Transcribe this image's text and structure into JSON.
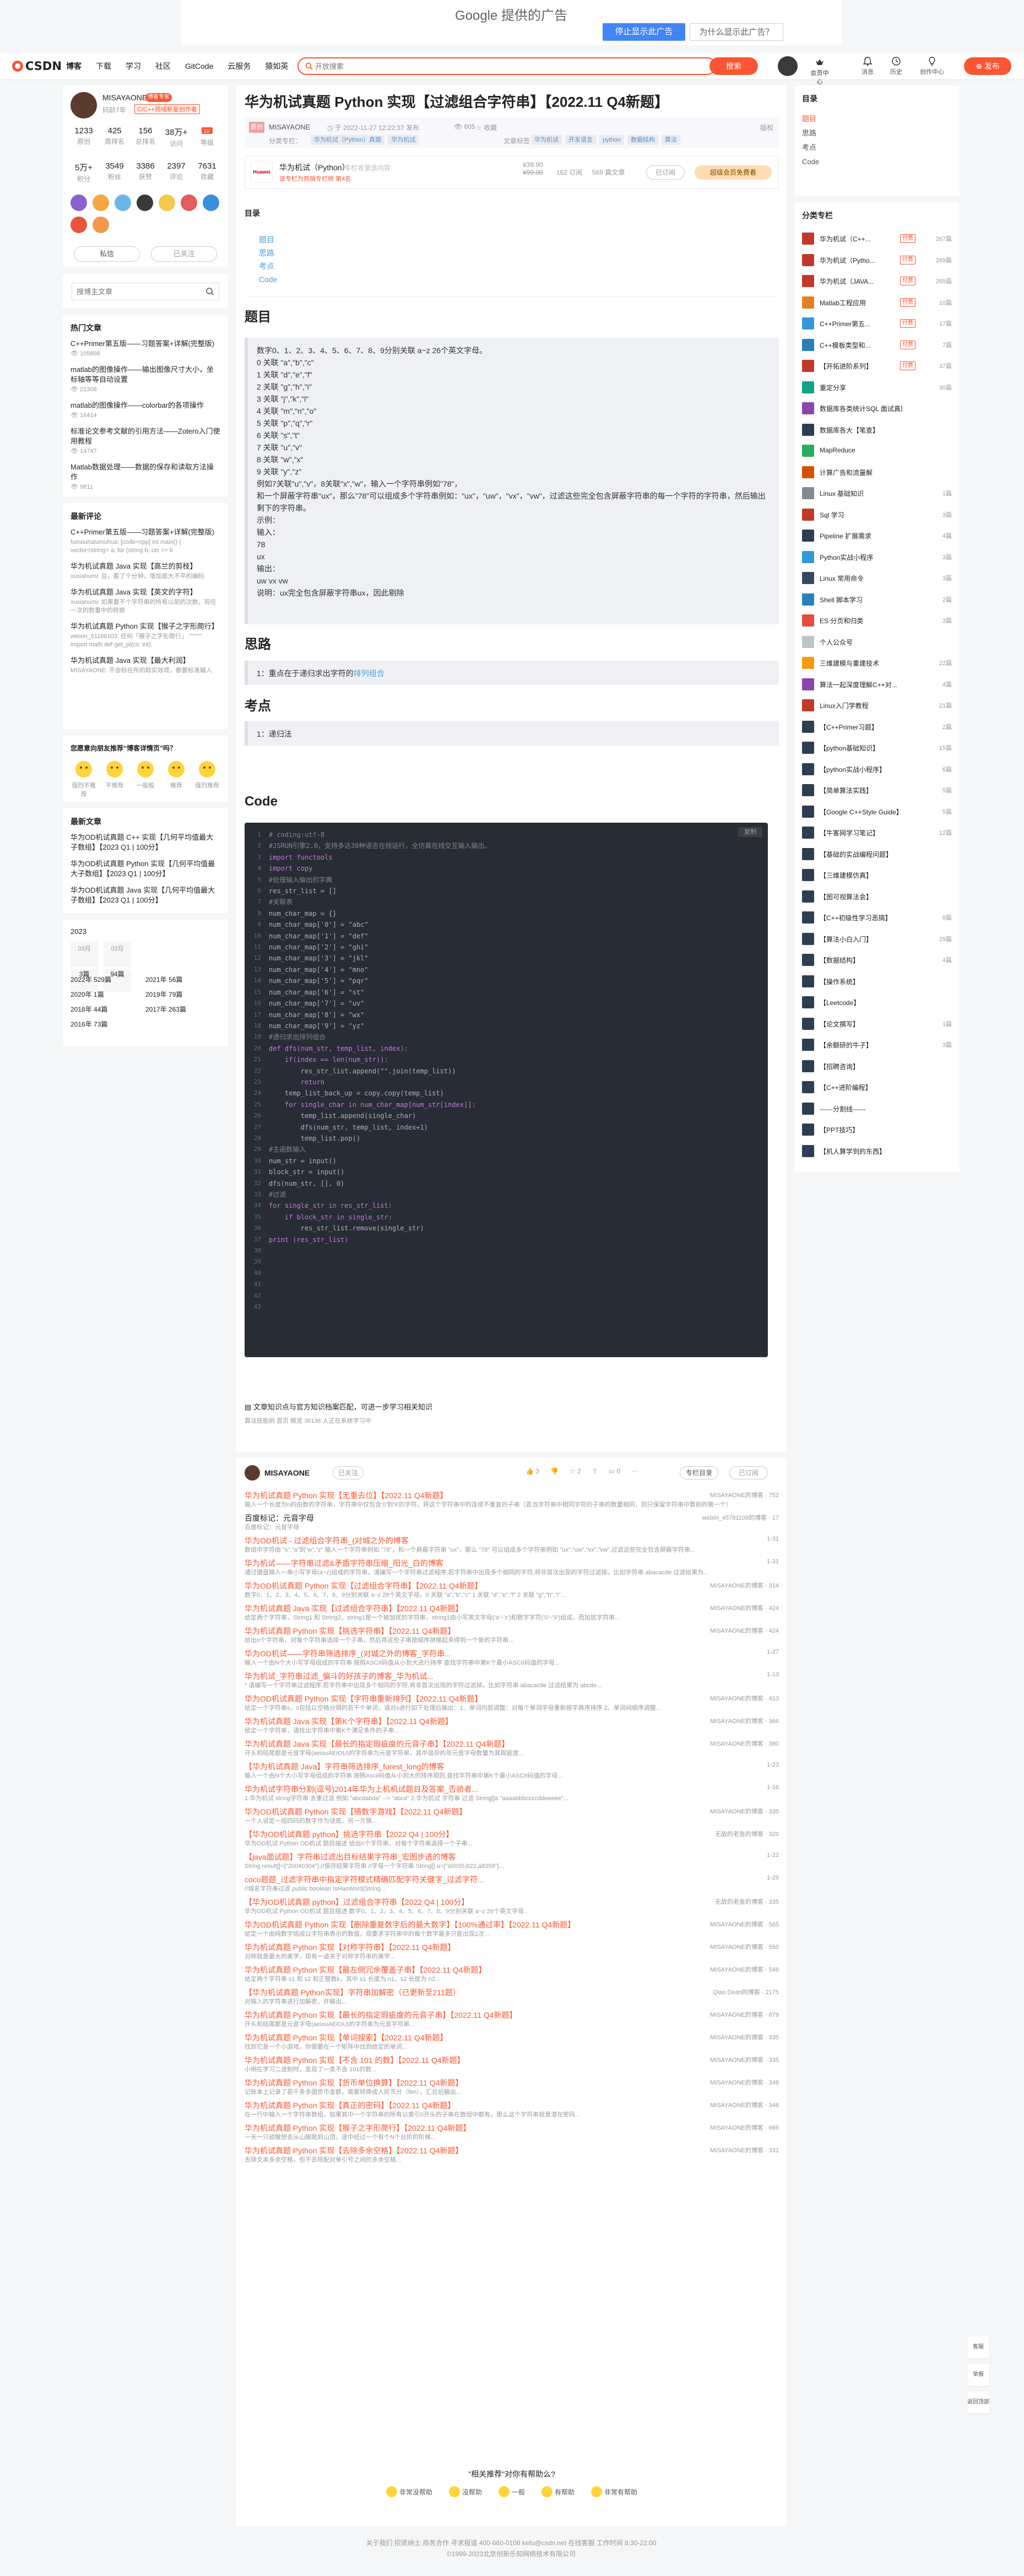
{
  "ad": {
    "brand": "Google 提供的广告",
    "stop_label": "停止显示此广告",
    "why_label": "为什么显示此广告？"
  },
  "toolbar": {
    "logo": "CSDN",
    "nav": [
      "博客",
      "下载",
      "学习",
      "社区",
      "GitCode",
      "云服务",
      "猿如英"
    ],
    "search_placeholder": "开放搜索",
    "search_button": "搜索",
    "vip_label": "会员中心",
    "items": [
      "消息",
      "历史",
      "创作中心"
    ],
    "publish_label": "发布"
  },
  "profile": {
    "name": "MISAYAONE",
    "badge": "博客专家",
    "code_age": "码龄7年",
    "blog_tag": "C/C++领域新星创作者",
    "stats1": [
      {
        "v": "1233",
        "l": "原创"
      },
      {
        "v": "425",
        "l": "周排名"
      },
      {
        "v": "156",
        "l": "总排名"
      },
      {
        "v": "38万+",
        "l": "访问"
      },
      {
        "v": "",
        "l": "等级"
      }
    ],
    "stats2": [
      {
        "v": "5万+",
        "l": "积分"
      },
      {
        "v": "3549",
        "l": "粉丝"
      },
      {
        "v": "3386",
        "l": "获赞"
      },
      {
        "v": "2397",
        "l": "评论"
      },
      {
        "v": "7631",
        "l": "收藏"
      }
    ],
    "badge_colors": [
      "#8a63d2",
      "#f4a742",
      "#6bb6e6",
      "#3a3a3a",
      "#f2c94c",
      "#e35d5d",
      "#3b8fdd",
      "#e8553a",
      "#f2994a"
    ],
    "dm_label": "私信",
    "follow_label": "已关注"
  },
  "left_search": {
    "placeholder": "搜博主文章"
  },
  "hot": {
    "title": "热门文章",
    "items": [
      {
        "t": "C++Primer第五版——习题答案+详解(完整版)",
        "m": "105898"
      },
      {
        "t": "matlab的图像操作——输出图像尺寸大小，坐标轴等等自动设置",
        "m": "21308"
      },
      {
        "t": "matlab的图像操作——colorbar的各项操作",
        "m": "16414"
      },
      {
        "t": "标准论文参考文献的引用方法——Zotero入门使用教程",
        "m": "14747"
      },
      {
        "t": "Matlab数据处理——数据的保存和读取方法操作",
        "m": "9811"
      }
    ]
  },
  "recent": {
    "title": "最新评论",
    "items": [
      {
        "t": "C++Primer第五版——习题答案+详解(完整版)",
        "d": "fumouhalumuhua: [code=cpp] int main() { vector<string> a; for (string b; cin >> b"
      },
      {
        "t": "华为机试真题 Java 实现【高兰的剪枝】",
        "d": "xuxiahumi: 且，看了个分钟，增加是大不平的编码"
      },
      {
        "t": "华为机试真题 Java 实现【英文的字符】",
        "d": "xuxiahumi: 如果要不个字符串的所有以前的次数，现在一次的数量中的转换"
      },
      {
        "t": "华为机试真题 Python 实现【猴子之字形爬行】",
        "d": "weixin_51166103: 任何「猴子之字形爬行」 \"\"\"\"\"\" import math def get_pi(cs: int):"
      },
      {
        "t": "华为机试真题 Java 实现【最大利润】",
        "d": "MISAYAONE: 不会标在所的取实效项，都要标准输入"
      }
    ]
  },
  "satisfaction": {
    "title": "您愿意向朋友推荐“博客详情页”吗？",
    "options": [
      "强烈不推荐",
      "不推荐",
      "一般般",
      "推荐",
      "强烈推荐"
    ]
  },
  "latest": {
    "title": "最新文章",
    "items": [
      "华为OD机试真题 C++ 实现【几何平均值最大子数组】【2023 Q1 | 100分】",
      "华为OD机试真题 Python 实现【几何平均值最大子数组】【2023 Q1 | 100分】",
      "华为OD机试真题 Java 实现【几何平均值最大子数组】【2023 Q1 | 100分】"
    ]
  },
  "archive": {
    "year": "2023",
    "months": [
      {
        "m": "03月",
        "c": "3篇"
      },
      {
        "m": "02月",
        "c": "94篇"
      }
    ],
    "years": [
      "2022年 529篇",
      "2021年 56篇",
      "2020年 1篇",
      "2019年 79篇",
      "2018年 44篇",
      "2017年 263篇",
      "2016年 73篇"
    ]
  },
  "article": {
    "title": "华为机试真题 Python 实现【过滤组合字符串】【2022.11 Q4新题】",
    "orig": "原创",
    "author": "MISAYAONE",
    "date": "于 2022-11-27 12:22:37 发布",
    "views": "605",
    "favs": "收藏",
    "copyright": "版权",
    "cats_label": "分类专栏：",
    "cats": [
      "华为机试（Python）真题",
      "华为机试"
    ],
    "tags_label": "文章标签：",
    "tags": [
      "华为机试",
      "开发语言",
      "python",
      "数据结构",
      "算法"
    ],
    "column": {
      "img_text": "Huawei",
      "name": "华为机试（Python）",
      "desc": "专栏收录该内容",
      "note": "该专栏为热销专栏榜 第4名",
      "price_new": "¥39.90",
      "price_old": "¥99.00",
      "subs": "162 订阅",
      "arts": "569 篇文章",
      "sub_btn": "已订阅",
      "vip_btn": "超级会员免费看"
    },
    "toc_title": "目录",
    "toc": [
      "题目",
      "思路",
      "考点",
      "Code"
    ],
    "h_problem": "题目",
    "problem_lines": [
      "数字0、1、2、3、4、5、6、7、8、9分别关联 a~z 26个英文字母。",
      "0 关联 \"a\",\"b\",\"c\"",
      "1 关联 \"d\",\"e\",\"f\"",
      "2 关联 \"g\",\"h\",\"i\"",
      "3 关联 \"j\",\"k\",\"l\"",
      "4 关联 \"m\",\"n\",\"o\"",
      "5 关联 \"p\",\"q\",\"r\"",
      "6 关联 \"s\",\"t\"",
      "7 关联 \"u\",\"v\"",
      "8 关联 \"w\",\"x\"",
      "9 关联 \"y\",\"z\"",
      "例如7关联\"u\",\"v\"，8关联\"x\",\"w\"，输入一个字符串例如\"78\"，",
      "和一个屏蔽字符串\"ux\"，那么\"78\"可以组成多个字符串例如：\"ux\"，\"uw\"，\"vx\"，\"vw\"，过滤这些完全包含屏蔽字符串的每一个字符的字符串，然后输出剩下的字符串。",
      "示例：",
      "输入：",
      "78",
      "ux",
      "输出：",
      "uw vx vw",
      "说明：ux完全包含屏蔽字符串ux，因此剔除"
    ],
    "h_idea": "思路",
    "idea": "1：重点在于递归求出字符的",
    "idea_link": "排列组合",
    "h_point": "考点",
    "point": "1：递归法",
    "h_code": "Code",
    "code_copy": "复制",
    "code": [
      "# coding:utf-8",
      "#JSRUN引擎2.0，支持多达30种语言在线运行，全仿真在线交互输入输出。",
      "import functools",
      "import copy",
      "#处理输入输出的字典",
      "res_str_list = []",
      "",
      "#关联表",
      "num_char_map = {}",
      "num_char_map['0'] = \"abc\"",
      "num_char_map['1'] = \"def\"",
      "num_char_map['2'] = \"ghi\"",
      "num_char_map['3'] = \"jkl\"",
      "num_char_map['4'] = \"mno\"",
      "num_char_map['5'] = \"pqr\"",
      "num_char_map['6'] = \"st\"",
      "num_char_map['7'] = \"uv\"",
      "num_char_map['8'] = \"wx\"",
      "num_char_map['9'] = \"yz\"",
      "",
      "#递归求出排列组合",
      "def dfs(num_str, temp_list, index):",
      "    if(index == len(num_str)):",
      "        res_str_list.append(\"\".join(temp_list))",
      "        return",
      "    temp_list_back_up = copy.copy(temp_list)",
      "    for single_char in num_char_map[num_str[index]]:",
      "        temp_list.append(single_char)",
      "        dfs(num_str, temp_list, index+1)",
      "        temp_list.pop()",
      "",
      "",
      "#主函数输入",
      "num_str = input()",
      "block_str = input()",
      "dfs(num_str, [], 0)",
      "",
      "#过滤",
      "for single_str in res_str_list:",
      "    if block_str in single_str:",
      "        res_str_list.remove(single_str)",
      "",
      "print (res_str_list)"
    ],
    "knowledge": "文章知识点与官方知识档案匹配，可进一步学习相关知识",
    "knowledge_sub": "算法技能树  首页  概览  36136 人正在系统学习中"
  },
  "author_bar": {
    "name": "MISAYAONE",
    "follow": "已关注",
    "acts": [
      "3",
      "",
      "2",
      "",
      "0",
      ""
    ],
    "gift": "专栏目录",
    "sub": "已订阅"
  },
  "recommend": [
    {
      "t": "华为机试真题 Python 实现【无重去位】【2022.11 Q4新题】",
      "d": "输入一个长度为n的由数的字符串，字符串中仅包含'0'到'9'的字符，将这个字符串中的连续不重复的子串（若当字符串中相同字符的子串的数量相同，则只保留字符串中靠前的第一个）",
      "m": "MISAYAONE的博客 · 752"
    },
    {
      "t": "百度标记：元音字母",
      "d": "百度标记：元音字母",
      "m": "weixin_45781109的博客 · 17"
    },
    {
      "t": "华为OD机试 - 过滤组合字符串_(对城之外的博客",
      "d": "数组中字符由 \"x\",\"a\"到\"w\",\"z\" 输入一个字符串例如 \"78\"，和一个屏蔽字符串 \"ux\"，那么 \"78\" 可以组成多个字符串例如 \"ux\",\"uw\",\"vx\",\"vw\",过滤这些完全包含屏蔽字符串...",
      "m": "1-31"
    },
    {
      "t": "华为机试——字符串过滤&矛盾字符串压缩_阳光_白的博客",
      "d": "通过键盘输入一串小写字母(a~z)组成的字符串。请编写一个字符串过滤程序,若字符串中出现多个相同的字符,将非首次出现的字符过滤掉。比如字符串 abacacde 过滤结果为...",
      "m": "1-31"
    },
    {
      "t": "华为OD机试真题 Python 实现【过滤组合字符串】【2022.11 Q4新题】",
      "d": "数字0、1、2、3、4、5、6、7、8、9分别关联 a~z 26个英文字母。0 关联 \"a\",\"b\",\"c\" 1 关联 \"d\",\"e\",\"f\" 2 关联 \"g\",\"h\",\"i\"...",
      "m": "MISAYAONE的博客 · 314"
    },
    {
      "t": "华为机试真题 Java 实现【过滤组合字符串】【2022.11 Q4新题】",
      "d": "给定两个字符串，String1 和 String2，string1是一个被加扰的字符串，string1由小写英文字母('a'~'z')和数字字符('0'~'9')组成，而加扰字符串...",
      "m": "MISAYAONE的博客 · 424"
    },
    {
      "t": "华为机试真题 Python 实现【挑选字符串】【2022.11 Q4新题】",
      "d": "给出n个字符串，对每个字符串选择一个子串，然后将这些子串按顺序拼接起来得到一个新的字符串...",
      "m": "MISAYAONE的博客 · 424"
    },
    {
      "t": "华为OD机试——字符串筛选排序_(对城之外的博客_字符串...",
      "d": "输入一个由N个大小写字母组成的字符串 按照ASCII码值从小到大进行排序 查找字符串中第K个最小ASCII码值的字母...",
      "m": "1-27"
    },
    {
      "t": "华为机试_字符串过滤_偏斗的好孩子的博客_华为机试...",
      "d": "* 请编写一个字符串过滤程序,若字符串中出现多个相同的字符,将非首次出现的字符过滤掉。比如字符串 abacacde 过滤结果为 abcde...",
      "m": "1-13"
    },
    {
      "t": "华为OD机试真题 Python 实现【字符串重新排列】【2022.11 Q4新题】",
      "d": "给定一个字符串s，s包括以空格分隔的若干个单词，请对s进行如下处理后输出：1、单词内部调整：对每个单词字母重新按字典序排序 2、单词间顺序调整...",
      "m": "MISAYAONE的博客 · 413"
    },
    {
      "t": "华为机试真题 Java 实现【第K个字符串】【2022.11 Q4新题】",
      "d": "给定一个字符串，请找出字符串中第K个满足条件的子串...",
      "m": "MISAYAONE的博客 · 366"
    },
    {
      "t": "华为机试真题 Java 实现【最长的指定瑕疵度的元音子串】【2022.11 Q4新题】",
      "d": "开头和结尾都是元音字母(aeiouAEIOU)的字符串为元音字符串，其中混杂的非元音字母数量为其瑕疵度...",
      "m": "MISAYAONE的博客 · 380"
    },
    {
      "t": "【华为机试真题 Java】字符串筛选排序_forest_long的博客",
      "d": "输入一个由N个大小写字母组成的字符串 按照Ascii码值从小到大的排序规则,查找字符串中第K个最小ASCII码值的字母...",
      "m": "1-23"
    },
    {
      "t": "华为机试字符串分割(逗号)2014年华为上机机试题目及答案_否骄者...",
      "d": "1.华为机试 string字符串 去重过滤 例如 \"abcdabda\" --> \"abcd\" 2.华为机试 字符串 过滤 String[]a \"aaaabbbccccddeeeee\"...",
      "m": "1-16"
    },
    {
      "t": "华为OD机试真题 Python 实现【猜数字游戏】【2022.11 Q4新题】",
      "d": "一个人设定一组四码的数字作为谜底，另一方猜...",
      "m": "MISAYAONE的博客 · 335"
    },
    {
      "t": "【华为OD机试真题 python】挑选字符串【2022 Q4 | 100分】",
      "d": "华为OD机试 Python  OD机试 题目描述 给出n个字符串，对每个字符串选择一个子串...",
      "m": "无敌的老鱼的博客 · 320"
    },
    {
      "t": "【java面试题】字符串过滤出目标结果字符串_宏图步选的博客",
      "d": "String result[]={\"20040304\"};//保存结果字符串 //字母一个字符串 String[] a={\"a0035,b22,a8359\"}...",
      "m": "1-22"
    },
    {
      "t": "coco题题_过滤字符串中指定字符模式精确匹配字符关键字_过滤字符...",
      "d": "//域名字符串过滤 public boolean IsHasWord(String...",
      "m": "1-29"
    },
    {
      "t": "【华为OD机试真题 python】过滤组合字符串【2022 Q4 | 100分】",
      "d": "华为OD机试 Python  OD机试 题目描述 数字0、1、2、3、4、5、6、7、8、9分别关联 a~z 26个英文字母...",
      "m": "无敌的老鱼的博客 · 335"
    },
    {
      "t": "华为OD机试真题 Python 实现【删除重复数字后的最大数字】【100%通过率】【2022.11 Q4新题】",
      "d": "给定一个由纯数字组成以字符串表示的数值，现要求字符串中的每个数字最多只能出现2次...",
      "m": "MISAYAONE的博客 · 565"
    },
    {
      "t": "华为机试真题 Python 实现【对称字符串】【2022.11 Q4新题】",
      "d": "对称就是最大的美学，现有一道关于对称字符串的美学...",
      "m": "MISAYAONE的博客 · 550"
    },
    {
      "t": "华为机试真题 Python 实现【最左侧冗余覆盖子串】【2022.11 Q4新题】",
      "d": "给定两个字符串 s1 和 s2 和正整数k，其中 s1 长度为 n1，s2 长度为 n2...",
      "m": "MISAYAONE的博客 · 546"
    },
    {
      "t": "【华为机试真题 Python实现】字符串加解密（已更新至211题）",
      "d": "对输入的字符串进行加解密，并输出...",
      "m": "Qiao Dean的博客 · 2175"
    },
    {
      "t": "华为机试真题 Python 实现【最长的指定瑕疵度的元音子串】【2022.11 Q4新题】",
      "d": "开头和结尾都是元音字母(aeiouAEIOU)的字符串为元音字符串...",
      "m": "MISAYAONE的博客 · 679"
    },
    {
      "t": "华为机试真题 Python 实现【单词搜索】【2022.11 Q4新题】",
      "d": "找到它是一个小游戏，你需要在一个矩阵中找到给定的单词...",
      "m": "MISAYAONE的博客 · 335"
    },
    {
      "t": "华为机试真题 Python 实现【不含 101 的数】【2022.11 Q4新题】",
      "d": "小明在学习二进制时，发现了一类不含 101的数...",
      "m": "MISAYAONE的博客 · 335"
    },
    {
      "t": "华为机试真题 Python 实现【货币单位换算】【2022.11 Q4新题】",
      "d": "记账本上记录了若干条多国货币金额，需要转换成人民币分（fen），汇总后输出...",
      "m": "MISAYAONE的博客 · 348"
    },
    {
      "t": "华为机试真题 Python 实现【真正的密码】【2022.11 Q4新题】",
      "d": "在一行中输入一个字符串数组，如果其中一个字符串的所有以索引0开头的子串在数组中都有，那么这个字符串就是潜在密码...",
      "m": "MISAYAONE的博客 · 348"
    },
    {
      "t": "华为机试真题 Python 实现【猴子之字形爬行】【2022.11 Q4新题】",
      "d": "一天一只顽猴想去从山脚爬到山顶，途中经过一个有个N个台阶的阶梯...",
      "m": "MISAYAONE的博客 · 666"
    },
    {
      "t": "华为机试真题 Python 实现【去除多余空格】【2022.11 Q4新题】",
      "d": "去除文本多余空格，但不去除配对单引号之间的多余空格...",
      "m": "MISAYAONE的博客 · 331"
    }
  ],
  "feedback": {
    "q": "\"相关推荐\"对你有帮助么?",
    "opts": [
      "非常没帮助",
      "没帮助",
      "一般",
      "有帮助",
      "非常有帮助"
    ]
  },
  "footer": {
    "line1": "关于我们  招贤纳士  商务合作  寻求报道  400-660-0108  kefu@csdn.net  在线客服  工作时间 8:30-22:00",
    "line2": "©1999-2023北京创新乐知网络技术有限公司"
  },
  "right_toc": {
    "title": "目录",
    "items": [
      "题目",
      "思路",
      "考点",
      "Code"
    ]
  },
  "right_cats": {
    "title": "分类专栏",
    "pay_label": "付费",
    "items": [
      {
        "n": "华为机试（C++...",
        "pay": true,
        "c": "267篇",
        "col": "#c0392b"
      },
      {
        "n": "华为机试（Pytho...",
        "pay": true,
        "c": "269篇",
        "col": "#c0392b"
      },
      {
        "n": "华为机试（JAVA...",
        "pay": true,
        "c": "269篇",
        "col": "#c0392b"
      },
      {
        "n": "Matlab工程应用",
        "pay": true,
        "c": "10篇",
        "col": "#e67e22"
      },
      {
        "n": "C++Primer第五...",
        "pay": true,
        "c": "17篇",
        "col": "#3498db"
      },
      {
        "n": "C++模板类型和...",
        "pay": true,
        "c": "7篇",
        "col": "#2980b9"
      },
      {
        "n": "【开拓进阶系列】",
        "pay": true,
        "c": "37篇",
        "col": "#c0392b"
      },
      {
        "n": "重定分享",
        "pay": false,
        "c": "30篇",
        "col": "#16a085"
      },
      {
        "n": "数据库各类统计SQL 面试真题",
        "pay": false,
        "c": "",
        "col": "#8e44ad"
      },
      {
        "n": "数据库各大【笔查】",
        "pay": false,
        "c": "",
        "col": "#2c3e50"
      },
      {
        "n": "MapReduce",
        "pay": false,
        "c": "",
        "col": "#27ae60"
      },
      {
        "n": "计算广告和流量解",
        "pay": false,
        "c": "",
        "col": "#d35400"
      },
      {
        "n": "Linux 基础知识",
        "pay": false,
        "c": "1篇",
        "col": "#7f8c8d"
      },
      {
        "n": "Sql 学习",
        "pay": false,
        "c": "3篇",
        "col": "#c0392b"
      },
      {
        "n": "Pipeline 扩展需求",
        "pay": false,
        "c": "4篇",
        "col": "#2c3e50"
      },
      {
        "n": "Python实战小程序",
        "pay": false,
        "c": "3篇",
        "col": "#3498db"
      },
      {
        "n": "Linux 常用命令",
        "pay": false,
        "c": "3篇",
        "col": "#34495e"
      },
      {
        "n": "Shell 脚本学习",
        "pay": false,
        "c": "2篇",
        "col": "#2980b9"
      },
      {
        "n": "ES 分页和归类",
        "pay": false,
        "c": "3篇",
        "col": "#e74c3c"
      },
      {
        "n": "个人公众号",
        "pay": false,
        "c": "",
        "col": "#bdc3c7"
      },
      {
        "n": "三维建模与重建技术",
        "pay": false,
        "c": "22篇",
        "col": "#f39c12"
      },
      {
        "n": "算法一起深度理解C++对...",
        "pay": false,
        "c": "4篇",
        "col": "#8e44ad"
      },
      {
        "n": "Linux入门学教程",
        "pay": false,
        "c": "21篇",
        "col": "#c0392b"
      },
      {
        "n": "【C++Primer习题】",
        "pay": false,
        "c": "2篇",
        "col": "#2c3e50"
      },
      {
        "n": "【python基础知识】",
        "pay": false,
        "c": "15篇",
        "col": "#2c3e50"
      },
      {
        "n": "【python实战小程序】",
        "pay": false,
        "c": "6篇",
        "col": "#2c3e50"
      },
      {
        "n": "【简单算法实践】",
        "pay": false,
        "c": "5篇",
        "col": "#2c3e50"
      },
      {
        "n": "【Google C++Style Guide】",
        "pay": false,
        "c": "5篇",
        "col": "#2c3e50"
      },
      {
        "n": "【牛客网学习笔记】",
        "pay": false,
        "c": "12篇",
        "col": "#2c3e50"
      },
      {
        "n": "【基础的实战编程问题】",
        "pay": false,
        "c": "",
        "col": "#2c3e50"
      },
      {
        "n": "【三维建模仿真】",
        "pay": false,
        "c": "",
        "col": "#2c3e50"
      },
      {
        "n": "【图可视算法会】",
        "pay": false,
        "c": "",
        "col": "#2c3e50"
      },
      {
        "n": "【C++初级性学习恶搞】",
        "pay": false,
        "c": "9篇",
        "col": "#2c3e50"
      },
      {
        "n": "【算法小白入门】",
        "pay": false,
        "c": "29篇",
        "col": "#2c3e50"
      },
      {
        "n": "【数据结构】",
        "pay": false,
        "c": "4篇",
        "col": "#2c3e50"
      },
      {
        "n": "【操作系统】",
        "pay": false,
        "c": "",
        "col": "#2c3e50"
      },
      {
        "n": "【Leetcode】",
        "pay": false,
        "c": "",
        "col": "#2c3e50"
      },
      {
        "n": "【论文撰写】",
        "pay": false,
        "c": "1篇",
        "col": "#2c3e50"
      },
      {
        "n": "【余额研的牛子】",
        "pay": false,
        "c": "3篇",
        "col": "#2c3e50"
      },
      {
        "n": "【招聘咨询】",
        "pay": false,
        "c": "",
        "col": "#2c3e50"
      },
      {
        "n": "【C++进阶编程】",
        "pay": false,
        "c": "",
        "col": "#2c3e50"
      },
      {
        "n": "------分割线------",
        "pay": false,
        "c": "",
        "col": "#2c3e50"
      },
      {
        "n": "【PPT技巧】",
        "pay": false,
        "c": "",
        "col": "#2c3e50"
      },
      {
        "n": "【机人算学到的东西】",
        "pay": false,
        "c": "",
        "col": "#2c3e50"
      }
    ]
  },
  "float_tools": [
    "客服",
    "举报",
    "返回顶部"
  ]
}
